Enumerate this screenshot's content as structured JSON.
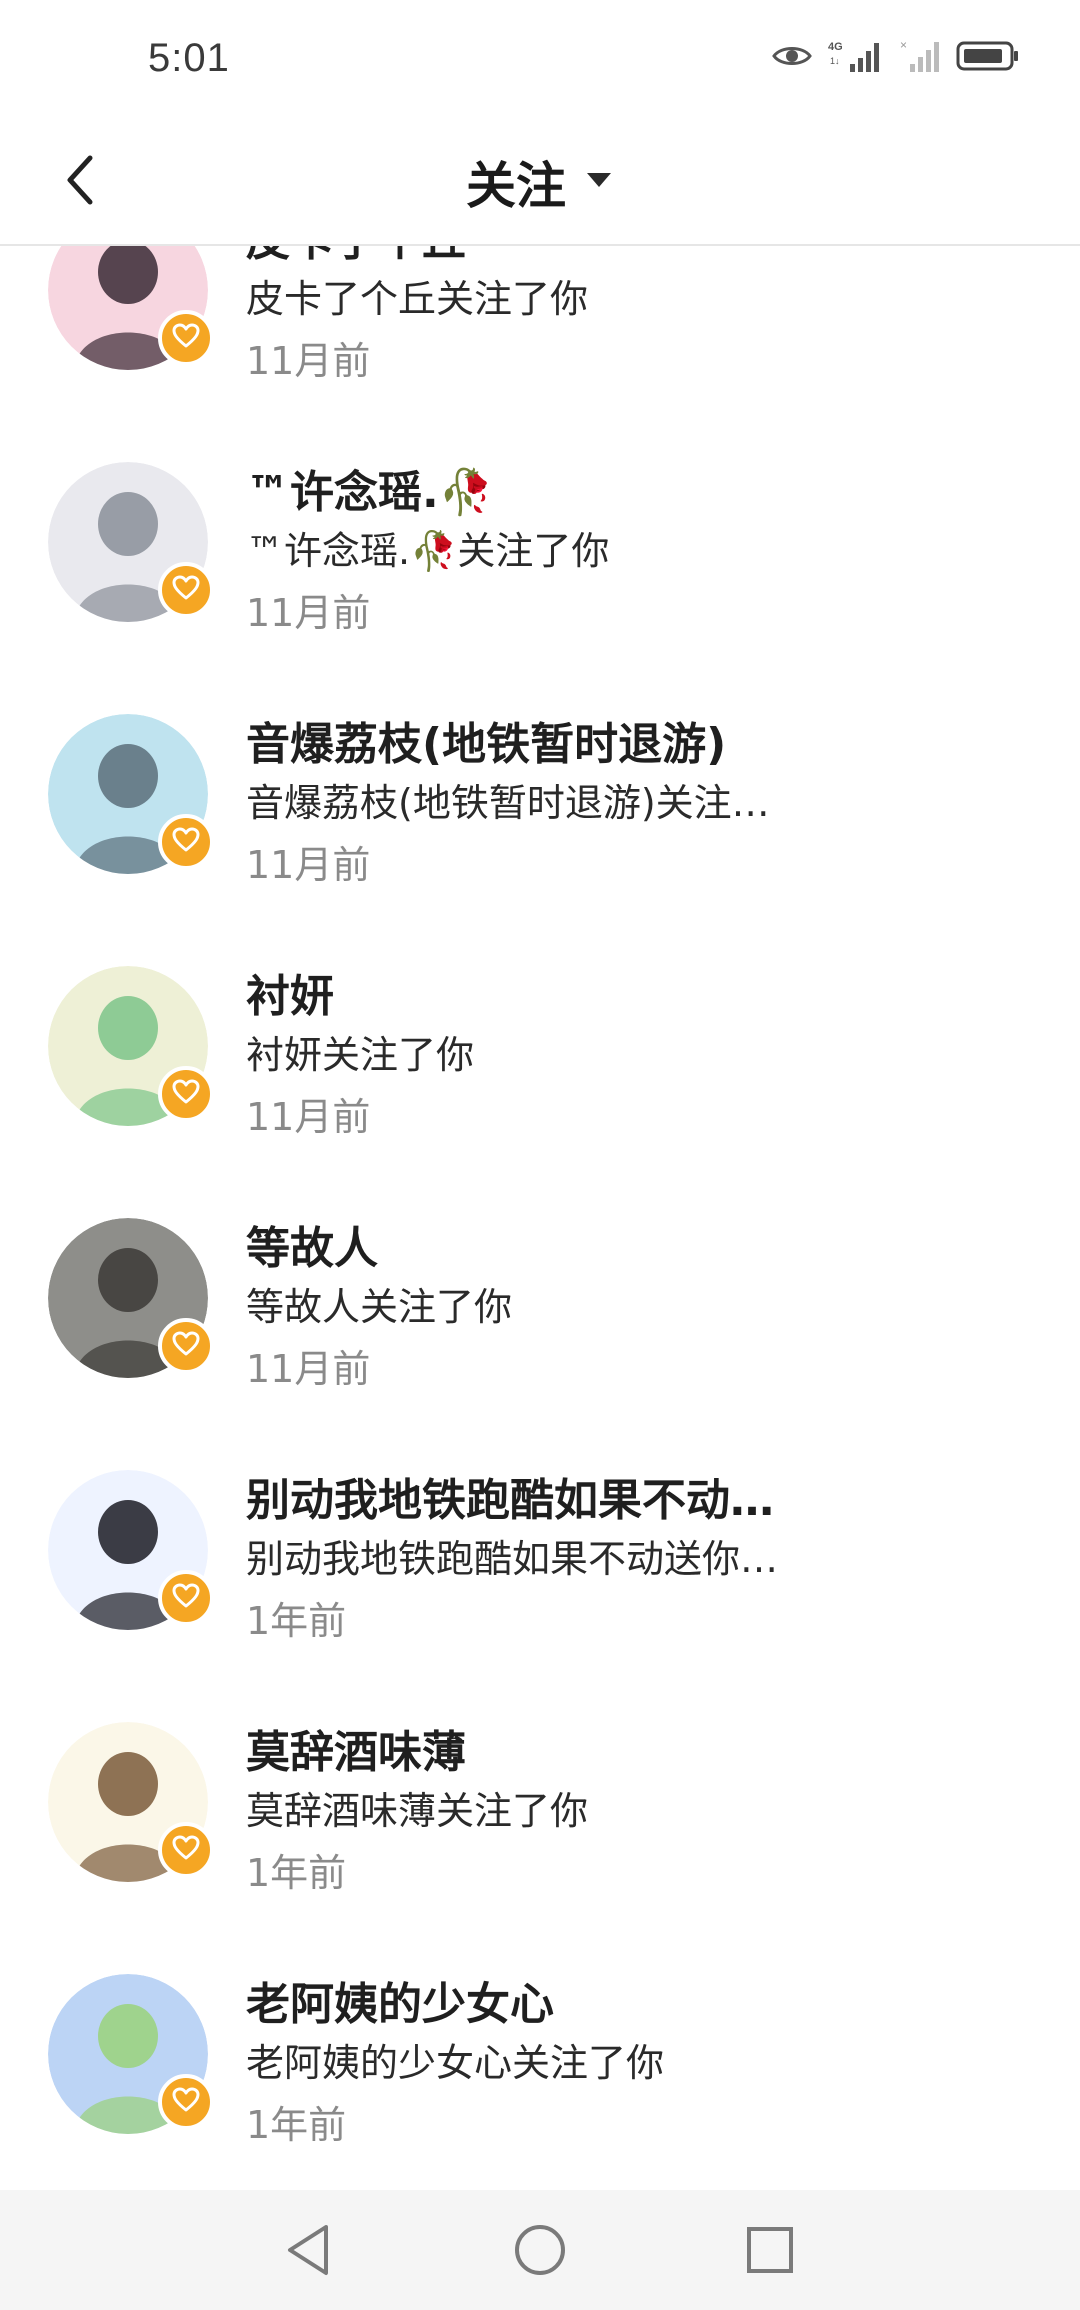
{
  "status_bar": {
    "time": "5:01",
    "icons": [
      "eye-icon",
      "signal-4g-icon",
      "signal-no-sim-icon",
      "battery-icon"
    ]
  },
  "header": {
    "title": "关注",
    "back_icon": "chevron-left-icon",
    "dropdown_icon": "caret-down-icon"
  },
  "notifications": [
    {
      "name": "皮卡了个丘",
      "desc": "皮卡了个丘关注了你",
      "time": "11月前",
      "avatar_colors": [
        "#f7d6e0",
        "#3a2a35"
      ]
    },
    {
      "name": "™许念瑶.🥀",
      "desc": "™许念瑶.🥀关注了你",
      "time": "11月前",
      "avatar_colors": [
        "#e9e9ee",
        "#8a8f99"
      ]
    },
    {
      "name": "音爆荔枝(地铁暂时退游)",
      "desc": "音爆荔枝(地铁暂时退游)关注…",
      "time": "11月前",
      "avatar_colors": [
        "#bfe3ef",
        "#5a6e7a"
      ]
    },
    {
      "name": "衬妍",
      "desc": "衬妍关注了你",
      "time": "11月前",
      "avatar_colors": [
        "#eef0d6",
        "#7cc489"
      ]
    },
    {
      "name": "等故人",
      "desc": "等故人关注了你",
      "time": "11月前",
      "avatar_colors": [
        "#8e8e8a",
        "#3c3a36"
      ]
    },
    {
      "name": "别动我地铁跑酷如果不动…",
      "desc": "别动我地铁跑酷如果不动送你…",
      "time": "1年前",
      "avatar_colors": [
        "#eef3ff",
        "#1b1b24"
      ]
    },
    {
      "name": "莫辞酒味薄",
      "desc": "莫辞酒味薄关注了你",
      "time": "1年前",
      "avatar_colors": [
        "#fbf7e8",
        "#7a5a3a"
      ]
    },
    {
      "name": "老阿姨的少女心",
      "desc": "老阿姨的少女心关注了你",
      "time": "1年前",
      "avatar_colors": [
        "#bcd4f5",
        "#9ad27a"
      ]
    }
  ],
  "colors": {
    "badge": "#f5a623",
    "time_text": "#8a8a8a",
    "nav_bar_bg": "#f5f5f5"
  },
  "nav_bar": {
    "icons": [
      "back-triangle-icon",
      "home-circle-icon",
      "recents-square-icon"
    ]
  }
}
